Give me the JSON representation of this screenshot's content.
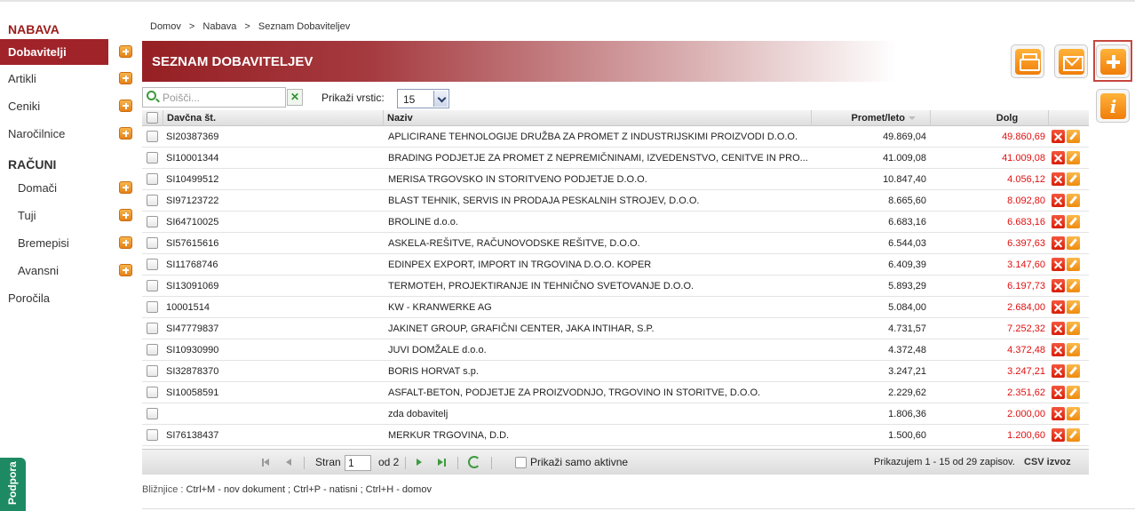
{
  "sidebar": {
    "section1_title": "NABAVA",
    "items": [
      {
        "label": "Dobavitelji",
        "active": true
      },
      {
        "label": "Artikli"
      },
      {
        "label": "Ceniki"
      },
      {
        "label": "Naročilnice"
      }
    ],
    "section2_title": "RAČUNI",
    "sub_items": [
      {
        "label": "Domači"
      },
      {
        "label": "Tuji"
      },
      {
        "label": "Bremepisi"
      },
      {
        "label": "Avansni"
      }
    ],
    "reports": "Poročila",
    "support_tab": "Podpora"
  },
  "breadcrumb": [
    "Domov",
    "Nabava",
    "Seznam Dobaviteljev"
  ],
  "breadcrumb_sep": ">",
  "page_title": "SEZNAM DOBAVITELJEV",
  "toolbar": {
    "search_placeholder": "Poišči...",
    "clear_symbol": "✕",
    "rows_label": "Prikaži vrstic:",
    "rows_value": "15"
  },
  "actions": {
    "info_symbol": "i"
  },
  "table": {
    "headers": {
      "tax": "Davčna št.",
      "name": "Naziv",
      "turnover": "Promet/leto",
      "debt": "Dolg"
    },
    "rows": [
      {
        "tax": "SI20387369",
        "name": "APLICIRANE TEHNOLOGIJE DRUŽBA ZA PROMET Z INDUSTRIJSKIMI PROIZVODI D.O.O.",
        "turnover": "49.869,04",
        "debt": "49.860,69"
      },
      {
        "tax": "SI10001344",
        "name": "BRADING PODJETJE ZA PROMET Z NEPREMIČNINAMI, IZVEDENSTVO, CENITVE IN PRO...",
        "turnover": "41.009,08",
        "debt": "41.009,08"
      },
      {
        "tax": "SI10499512",
        "name": "MERISA TRGOVSKO IN STORITVENO PODJETJE D.O.O.",
        "turnover": "10.847,40",
        "debt": "4.056,12"
      },
      {
        "tax": "SI97123722",
        "name": "BLAST TEHNIK, SERVIS IN PRODAJA PESKALNIH STROJEV, D.O.O.",
        "turnover": "8.665,60",
        "debt": "8.092,80"
      },
      {
        "tax": "SI64710025",
        "name": "BROLINE d.o.o.",
        "turnover": "6.683,16",
        "debt": "6.683,16"
      },
      {
        "tax": "SI57615616",
        "name": "ASKELA-REŠITVE, RAČUNOVODSKE REŠITVE, D.O.O.",
        "turnover": "6.544,03",
        "debt": "6.397,63"
      },
      {
        "tax": "SI11768746",
        "name": "EDINPEX EXPORT, IMPORT IN TRGOVINA D.O.O. KOPER",
        "turnover": "6.409,39",
        "debt": "3.147,60"
      },
      {
        "tax": "SI13091069",
        "name": "TERMOTEH, PROJEKTIRANJE IN TEHNIČNO SVETOVANJE D.O.O.",
        "turnover": "5.893,29",
        "debt": "6.197,73"
      },
      {
        "tax": "10001514",
        "name": "KW - KRANWERKE AG",
        "turnover": "5.084,00",
        "debt": "2.684,00"
      },
      {
        "tax": "SI47779837",
        "name": "JAKINET GROUP, GRAFIČNI CENTER, JAKA INTIHAR, S.P.",
        "turnover": "4.731,57",
        "debt": "7.252,32"
      },
      {
        "tax": "SI10930990",
        "name": "JUVI DOMŽALE d.o.o.",
        "turnover": "4.372,48",
        "debt": "4.372,48"
      },
      {
        "tax": "SI32878370",
        "name": "BORIS HORVAT s.p.",
        "turnover": "3.247,21",
        "debt": "3.247,21"
      },
      {
        "tax": "SI10058591",
        "name": "ASFALT-BETON, PODJETJE ZA PROIZVODNJO, TRGOVINO IN STORITVE, D.O.O.",
        "turnover": "2.229,62",
        "debt": "2.351,62"
      },
      {
        "tax": "",
        "name": "zda dobavitelj",
        "turnover": "1.806,36",
        "debt": "2.000,00"
      },
      {
        "tax": "SI76138437",
        "name": "MERKUR TRGOVINA, D.D.",
        "turnover": "1.500,60",
        "debt": "1.200,60"
      }
    ]
  },
  "pager": {
    "page_label": "Stran",
    "page_value": "1",
    "of_label": "od 2",
    "only_active_label": "Prikaži samo aktivne",
    "info": "Prikazujem 1 - 15 od 29 zapisov.",
    "csv": "CSV izvoz"
  },
  "shortcuts": {
    "label": "Bližnjice :",
    "text": "Ctrl+M - nov dokument ;  Ctrl+P - natisni ;  Ctrl+H - domov"
  },
  "colors": {
    "brand": "#a0232a",
    "accent_orange": "#f07e0a",
    "debt_red": "#e01010",
    "support_green": "#1e8a63"
  }
}
